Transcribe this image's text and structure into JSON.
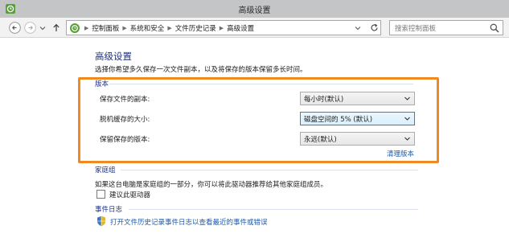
{
  "window": {
    "title": "高级设置"
  },
  "nav": {
    "breadcrumb": [
      "控制面板",
      "系统和安全",
      "文件历史记录",
      "高级设置"
    ],
    "search_placeholder": "搜索控制面板"
  },
  "page": {
    "title": "高级设置",
    "description": "选择你希望多久保存一次文件副本，以及将保存的版本保留多长时间。"
  },
  "versions": {
    "group_label": "版本",
    "rows": [
      {
        "label": "保存文件的副本:",
        "value": "每小时(默认)"
      },
      {
        "label": "脱机缓存的大小:",
        "value": "磁盘空间的 5% (默认)"
      },
      {
        "label": "保留保存的版本:",
        "value": "永远(默认)"
      }
    ],
    "cleanup_link": "清理版本"
  },
  "homegroup": {
    "group_label": "家庭组",
    "description": "如果这台电脑是家庭组的一部分，你可以将此驱动器推荐给其他家庭组成员。",
    "checkbox_label": "建议此驱动器",
    "checked": false
  },
  "eventlog": {
    "group_label": "事件日志",
    "link": "打开文件历史记录事件日志以查看最近的事件或错误"
  },
  "colors": {
    "accent_title": "#1e3287",
    "link": "#1e5aa8",
    "highlight": "#f0891f"
  }
}
